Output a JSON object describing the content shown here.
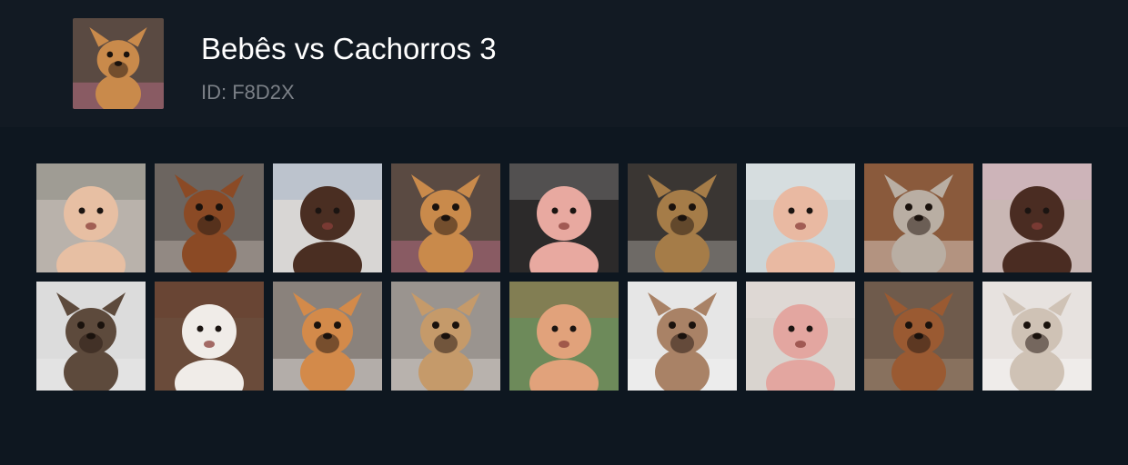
{
  "quiz": {
    "title": "Bebês vs Cachorros 3",
    "id_text": "ID: F8D2X",
    "cover": {
      "kind": "dog",
      "icon": "dog-howling-icon",
      "bg": "#5a4a42",
      "skin": "#c98a4b",
      "accent": "#e27aa0"
    }
  },
  "tiles": [
    {
      "kind": "baby",
      "icon": "baby-shirtless-icon",
      "bg": "#b9b2ab",
      "skin": "#e7bfa3",
      "accent": "#2f3a2c"
    },
    {
      "kind": "dog",
      "icon": "dachshund-icon",
      "bg": "#6c6560",
      "skin": "#8b4a25",
      "accent": "#d9cfc5"
    },
    {
      "kind": "baby",
      "icon": "baby-crying-icon",
      "bg": "#d8d6d4",
      "skin": "#4a2e22",
      "accent": "#3d6fb0"
    },
    {
      "kind": "dog",
      "icon": "dog-howling-icon",
      "bg": "#5a4a42",
      "skin": "#c98a4b",
      "accent": "#e27aa0"
    },
    {
      "kind": "baby",
      "icon": "baby-grumpy-icon",
      "bg": "#2c2a2a",
      "skin": "#e8a9a0",
      "accent": "#ffffff"
    },
    {
      "kind": "dog",
      "icon": "dog-snarling-icon",
      "bg": "#3a3633",
      "skin": "#a57c48",
      "accent": "#d0cbc5"
    },
    {
      "kind": "baby",
      "icon": "baby-pouting-icon",
      "bg": "#cdd6d8",
      "skin": "#e9b9a2",
      "accent": "#ffffff"
    },
    {
      "kind": "dog",
      "icon": "dog-sunglasses-icon",
      "bg": "#8a5a3c",
      "skin": "#b9aea3",
      "accent": "#ffffff"
    },
    {
      "kind": "baby",
      "icon": "baby-side-eye-icon",
      "bg": "#c9b7b4",
      "skin": "#4a2c22",
      "accent": "#e3a7d0"
    },
    {
      "kind": "dog",
      "icon": "chihuahua-icon",
      "bg": "#dcdcdc",
      "skin": "#5d4a3c",
      "accent": "#f2f2f2"
    },
    {
      "kind": "baby",
      "icon": "baby-handstand-icon",
      "bg": "#6a4b3a",
      "skin": "#f0ece8",
      "accent": "#6a2a1a"
    },
    {
      "kind": "dog",
      "icon": "corgi-icon",
      "bg": "#8a827c",
      "skin": "#d38a4a",
      "accent": "#ffffff"
    },
    {
      "kind": "dog",
      "icon": "chihuahua-handstand-icon",
      "bg": "#9a948f",
      "skin": "#c59a6a",
      "accent": "#f0ebe5"
    },
    {
      "kind": "baby",
      "icon": "baby-playroom-icon",
      "bg": "#6d8a5a",
      "skin": "#e1a27b",
      "accent": "#e4483a"
    },
    {
      "kind": "dog",
      "icon": "poodle-standing-icon",
      "bg": "#e6e6e6",
      "skin": "#a98266",
      "accent": "#f5f5f5"
    },
    {
      "kind": "baby",
      "icon": "baby-bath-icon",
      "bg": "#d9d4cf",
      "skin": "#e3a6a0",
      "accent": "#f3f0ee"
    },
    {
      "kind": "dog",
      "icon": "pitbull-icon",
      "bg": "#6f5b4c",
      "skin": "#9a5a32",
      "accent": "#b79a80"
    },
    {
      "kind": "dog",
      "icon": "puppy-in-bed-icon",
      "bg": "#e7e2df",
      "skin": "#cfc2b5",
      "accent": "#ffffff"
    }
  ]
}
